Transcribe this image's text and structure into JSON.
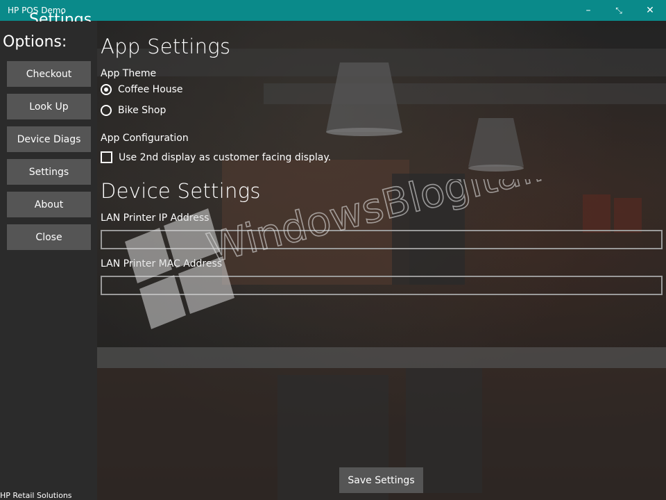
{
  "window": {
    "title": "HP POS Demo",
    "controls": {
      "minimize": "–",
      "restore": "⤡",
      "close": "✕"
    }
  },
  "sidebar": {
    "page_heading": "Settings",
    "options_label": "Options:",
    "items": [
      {
        "label": "Checkout"
      },
      {
        "label": "Look Up"
      },
      {
        "label": "Device Diags"
      },
      {
        "label": "Settings"
      },
      {
        "label": "About"
      },
      {
        "label": "Close"
      }
    ],
    "footer": "HP Retail Solutions"
  },
  "app_settings": {
    "heading": "App Settings",
    "theme_label": "App Theme",
    "themes": [
      {
        "label": "Coffee House",
        "checked": true
      },
      {
        "label": "Bike Shop",
        "checked": false
      }
    ],
    "config_label": "App Configuration",
    "second_display": {
      "label": "Use 2nd display as customer facing display.",
      "checked": false
    }
  },
  "device_settings": {
    "heading": "Device Settings",
    "printer_ip_label": "LAN Printer IP Address",
    "printer_ip_value": "",
    "printer_mac_label": "LAN Printer MAC Address",
    "printer_mac_value": ""
  },
  "save_button": "Save Settings",
  "watermark": "WindowsBlogItalia",
  "colors": {
    "titlebar": "#0a8a8a",
    "sidebar": "#2b2b2b",
    "button": "#555555",
    "field_border": "#9a9a9a"
  }
}
